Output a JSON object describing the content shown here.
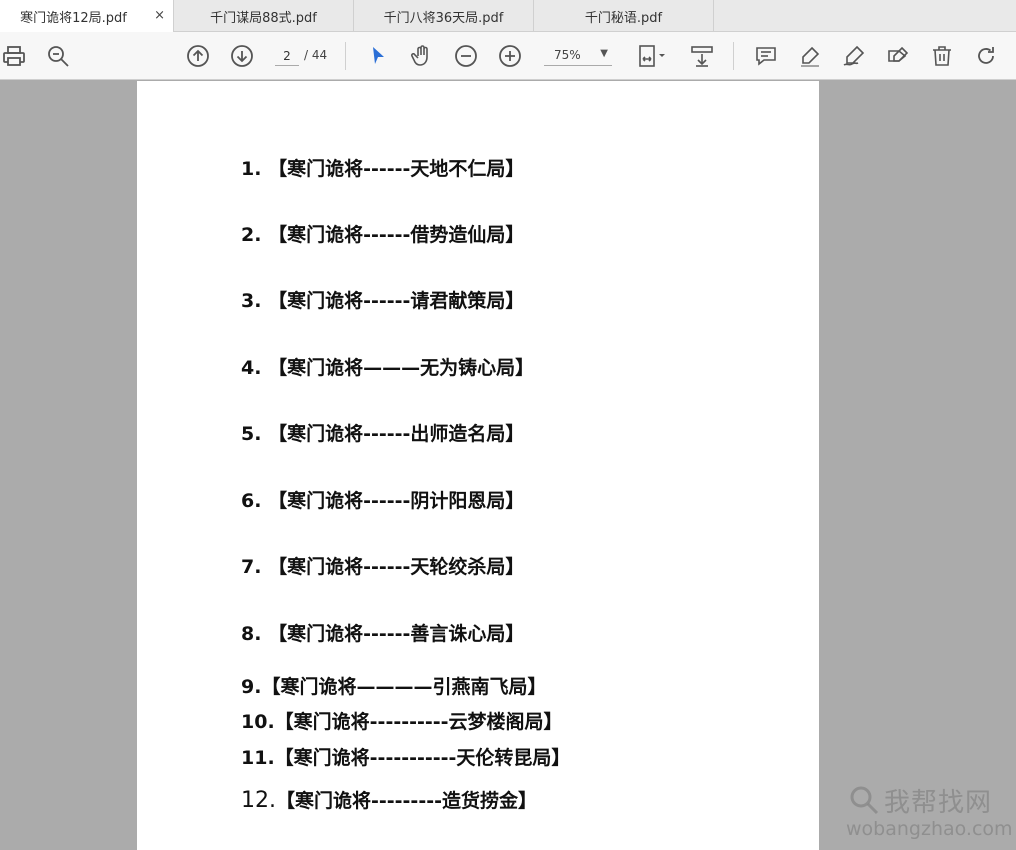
{
  "tabs": [
    {
      "label": "寒门诡将12局.pdf",
      "active": true,
      "close": "×"
    },
    {
      "label": "千门谋局88式.pdf",
      "active": false
    },
    {
      "label": "千门八将36天局.pdf",
      "active": false
    },
    {
      "label": "千门秘语.pdf",
      "active": false
    }
  ],
  "toolbar": {
    "page_current": "2",
    "page_total": "/ 44",
    "zoom": "75%",
    "zoom_arrow": "▼"
  },
  "document": {
    "lines": [
      {
        "num": "1.",
        "text": "【寒门诡将------天地不仁局】"
      },
      {
        "num": "2.",
        "text": "【寒门诡将------借势造仙局】"
      },
      {
        "num": "3.",
        "text": "【寒门诡将------请君献策局】"
      },
      {
        "num": "4.",
        "text": "【寒门诡将———无为铸心局】"
      },
      {
        "num": "5.",
        "text": "【寒门诡将------出师造名局】"
      },
      {
        "num": "6.",
        "text": "【寒门诡将------阴计阳恩局】"
      },
      {
        "num": "7.",
        "text": "【寒门诡将------天轮绞杀局】"
      },
      {
        "num": "8.",
        "text": "【寒门诡将------善言诛心局】"
      },
      {
        "num": "9.",
        "text": "【寒门诡将————引燕南飞局】"
      },
      {
        "num": "10.",
        "text": "【寒门诡将----------云梦楼阁局】"
      },
      {
        "num": "11.",
        "text": "【寒门诡将-----------天伦转昆局】"
      },
      {
        "num": "12.",
        "text": "【寒门诡将---------造货捞金】"
      }
    ]
  },
  "watermark": {
    "name": "我帮找网",
    "url": "wobangzhao.com"
  },
  "colors": {
    "accent": "#2b6fd6",
    "page_bg": "#ffffff",
    "viewer_bg": "#ababab"
  }
}
